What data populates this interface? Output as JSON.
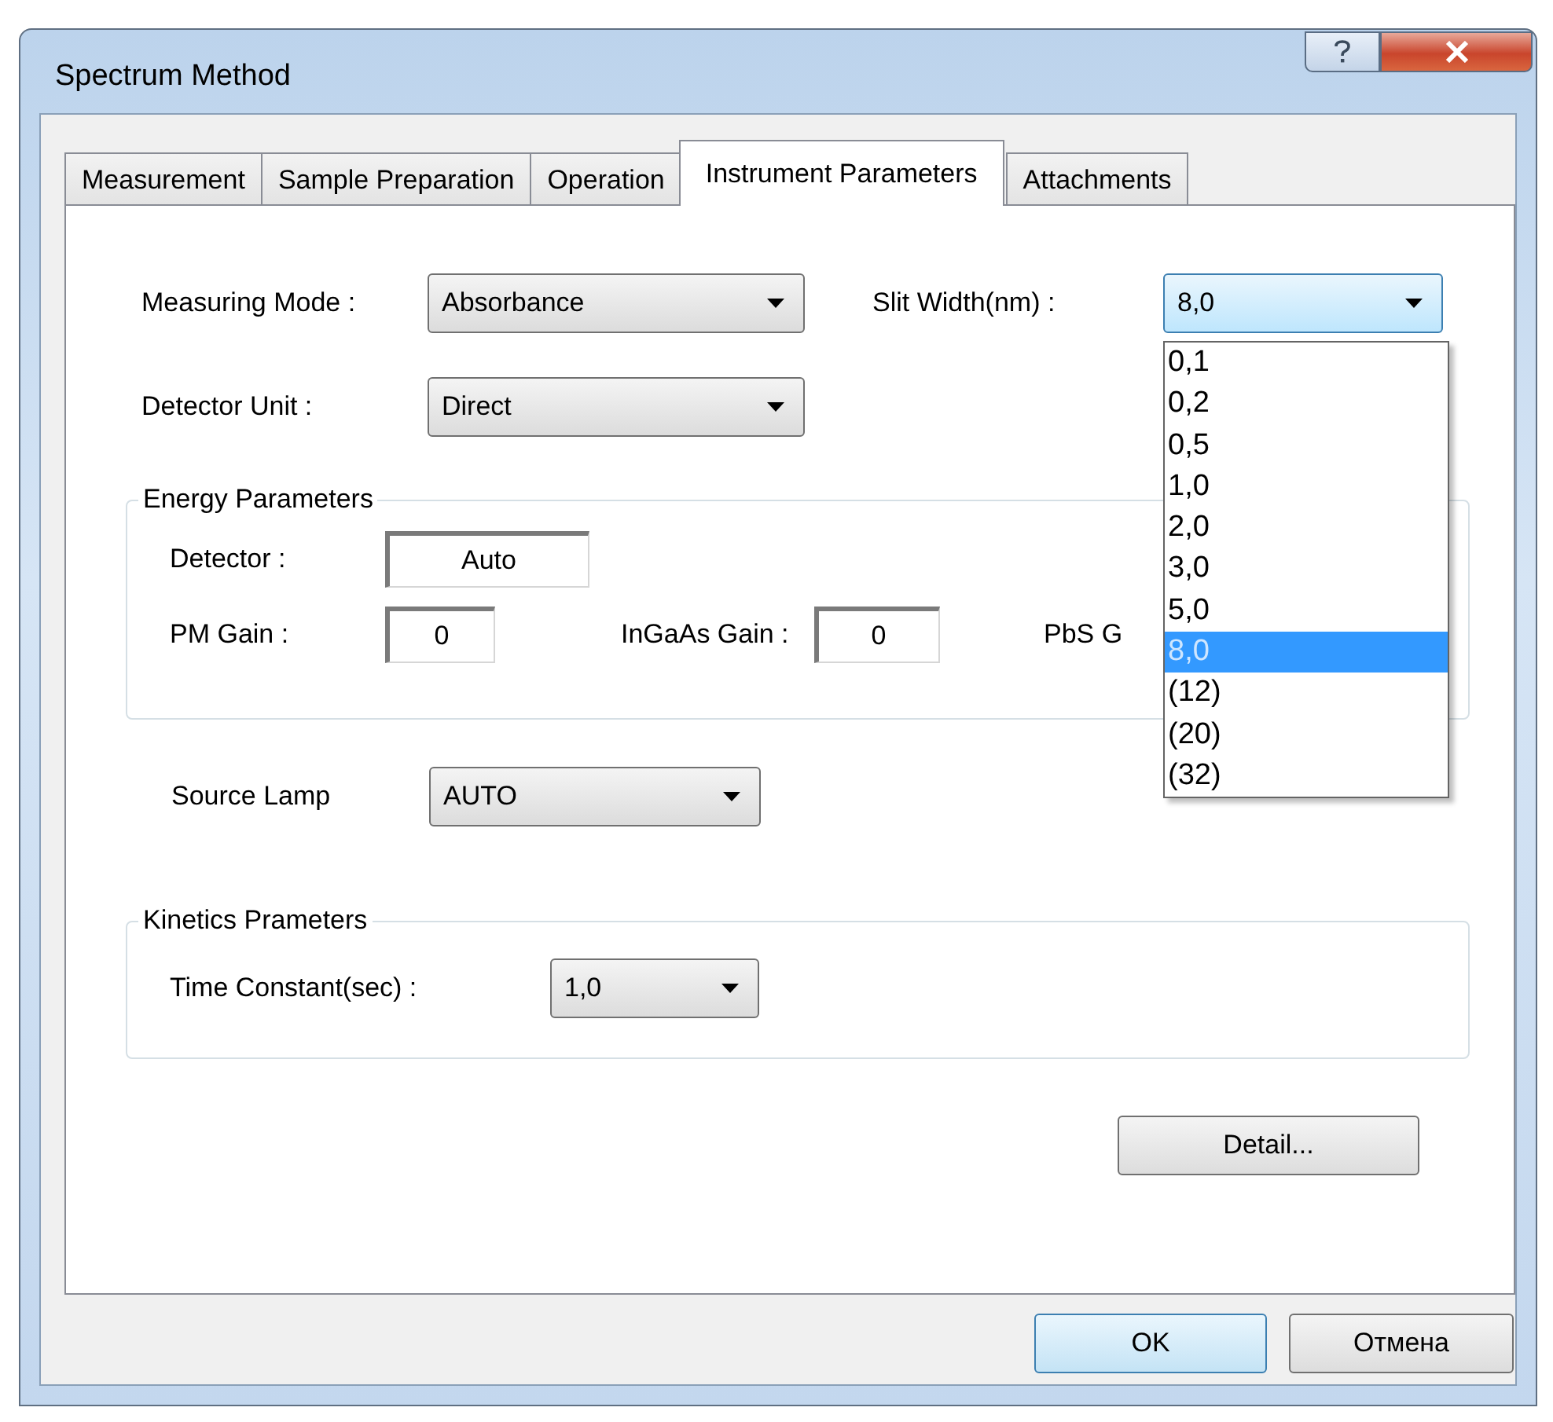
{
  "window": {
    "title": "Spectrum Method"
  },
  "tabs": [
    {
      "label": "Measurement",
      "selected": false
    },
    {
      "label": "Sample Preparation",
      "selected": false
    },
    {
      "label": "Operation",
      "selected": false
    },
    {
      "label": "Instrument Parameters",
      "selected": true
    },
    {
      "label": "Attachments",
      "selected": false
    }
  ],
  "measuring_mode": {
    "label": "Measuring Mode :",
    "value": "Absorbance"
  },
  "slit_width": {
    "label": "Slit Width(nm) :",
    "value": "8,0",
    "expanded": true,
    "options": [
      {
        "label": "0,1",
        "selected": false
      },
      {
        "label": "0,2",
        "selected": false
      },
      {
        "label": "0,5",
        "selected": false
      },
      {
        "label": "1,0",
        "selected": false
      },
      {
        "label": "2,0",
        "selected": false
      },
      {
        "label": "3,0",
        "selected": false
      },
      {
        "label": "5,0",
        "selected": false
      },
      {
        "label": "8,0",
        "selected": true
      },
      {
        "label": "(12)",
        "selected": false
      },
      {
        "label": "(20)",
        "selected": false
      },
      {
        "label": "(32)",
        "selected": false
      }
    ]
  },
  "detector_unit": {
    "label": "Detector Unit :",
    "value": "Direct"
  },
  "energy_parameters": {
    "title": "Energy Parameters",
    "detector": {
      "label": "Detector :",
      "value": "Auto"
    },
    "pm_gain": {
      "label": "PM Gain :",
      "value": "0"
    },
    "ingaas_gain": {
      "label": "InGaAs Gain :",
      "value": "0"
    },
    "pbs_gain_label": "PbS G"
  },
  "source_lamp": {
    "label": "Source Lamp",
    "value": "AUTO"
  },
  "kinetics_parameters": {
    "title": "Kinetics Prameters",
    "time_constant": {
      "label": "Time Constant(sec) :",
      "value": "1,0"
    }
  },
  "buttons": {
    "detail": "Detail...",
    "ok": "OK",
    "cancel": "Отмена"
  }
}
